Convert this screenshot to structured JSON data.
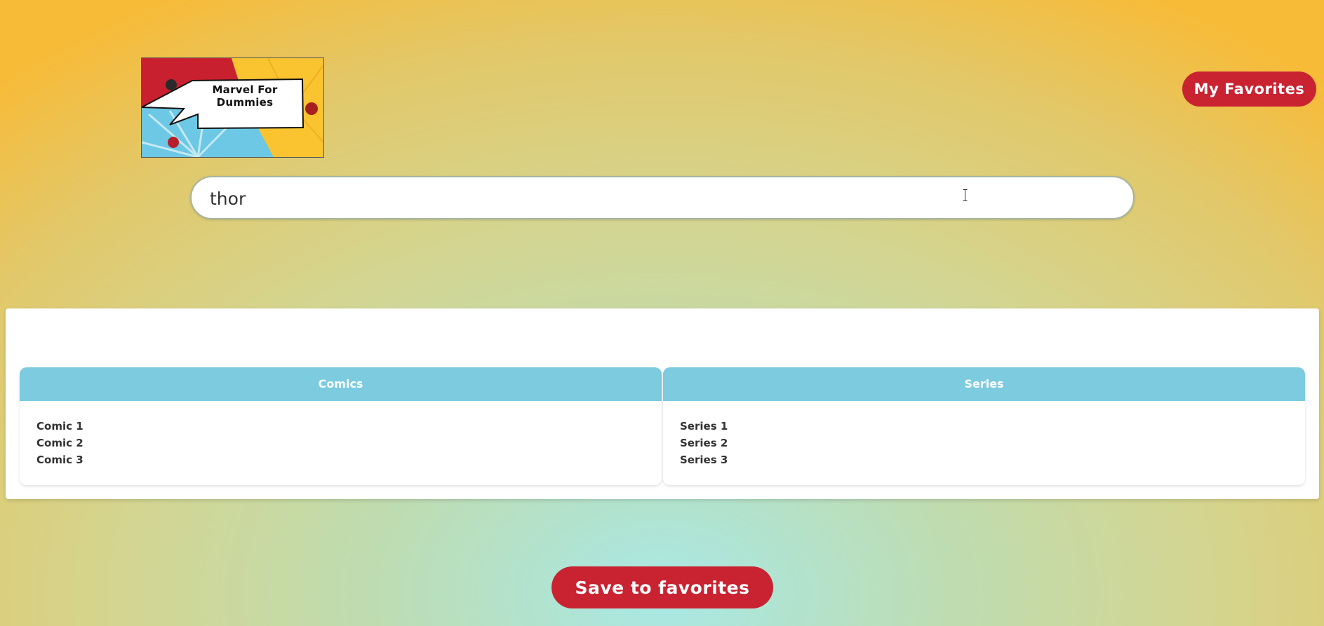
{
  "header": {
    "logo_text": "Marvel For Dummies",
    "favorites_label": "My Favorites"
  },
  "search": {
    "value": "thor",
    "placeholder": ""
  },
  "results": {
    "comics": {
      "title": "Comics",
      "items": [
        "Comic 1",
        "Comic 2",
        "Comic 3"
      ]
    },
    "series": {
      "title": "Series",
      "items": [
        "Series 1",
        "Series 2",
        "Series 3"
      ]
    }
  },
  "actions": {
    "save_label": "Save to favorites"
  },
  "colors": {
    "accent_red": "#c92231",
    "card_header": "#7ccbdf"
  },
  "icons": [
    "text-cursor-icon"
  ]
}
